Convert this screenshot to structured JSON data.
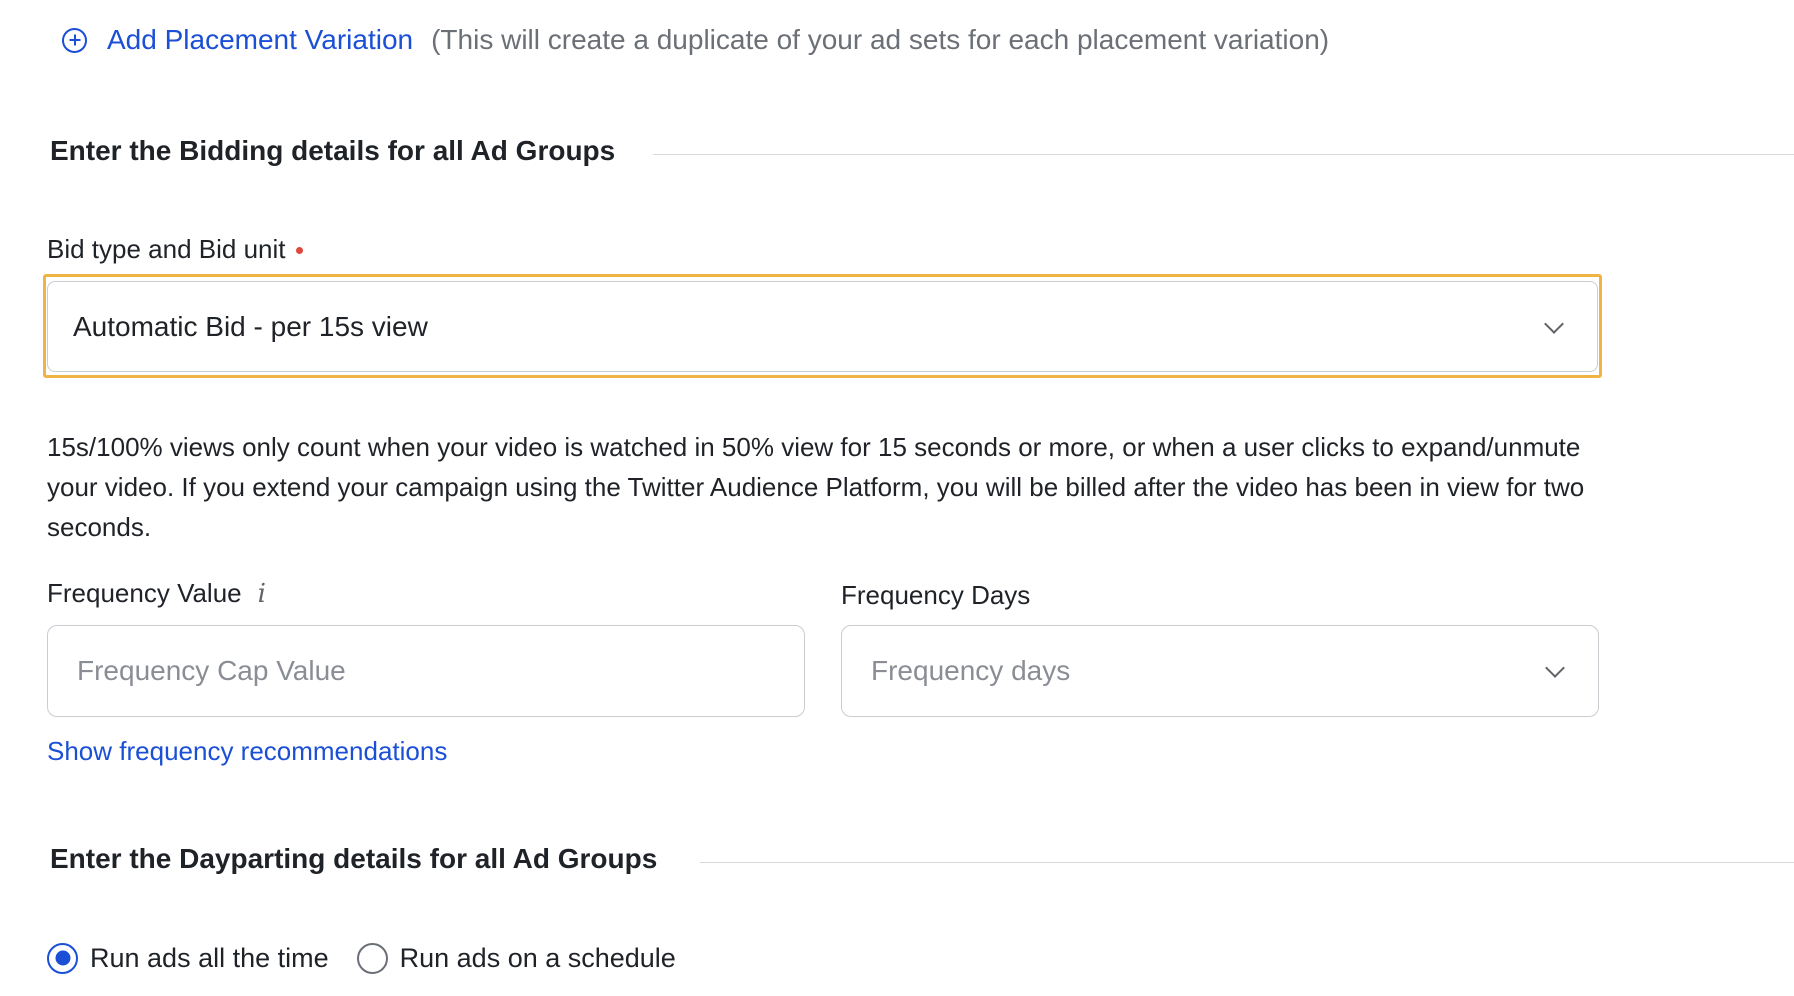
{
  "placement": {
    "add_label": "Add Placement Variation",
    "hint": "(This will create a duplicate of your ad sets for each placement variation)",
    "icon": "plus-circle-icon"
  },
  "bidding_section": {
    "title": "Enter the Bidding details for all Ad Groups",
    "bid_label": "Bid type and Bid unit",
    "bid_value": "Automatic Bid - per 15s view",
    "description": "15s/100% views only count when your video is watched in 50% view for 15 seconds or more, or when a user clicks to expand/unmute your video. If you extend your campaign using the Twitter Audience Platform, you will be billed after the video has been in view for two seconds.",
    "frequency_value_label": "Frequency Value",
    "frequency_value_info": "i",
    "frequency_value_placeholder": "Frequency Cap Value",
    "frequency_days_label": "Frequency Days",
    "frequency_days_placeholder": "Frequency days",
    "recommendations_link": "Show frequency recommendations"
  },
  "dayparting_section": {
    "title": "Enter the Dayparting details for all Ad Groups",
    "options": [
      {
        "label": "Run ads all the time",
        "selected": true
      },
      {
        "label": "Run ads on a schedule",
        "selected": false
      }
    ]
  },
  "colors": {
    "link": "#1a4fd6",
    "focus": "#f0b446",
    "required": "#e0483d"
  }
}
